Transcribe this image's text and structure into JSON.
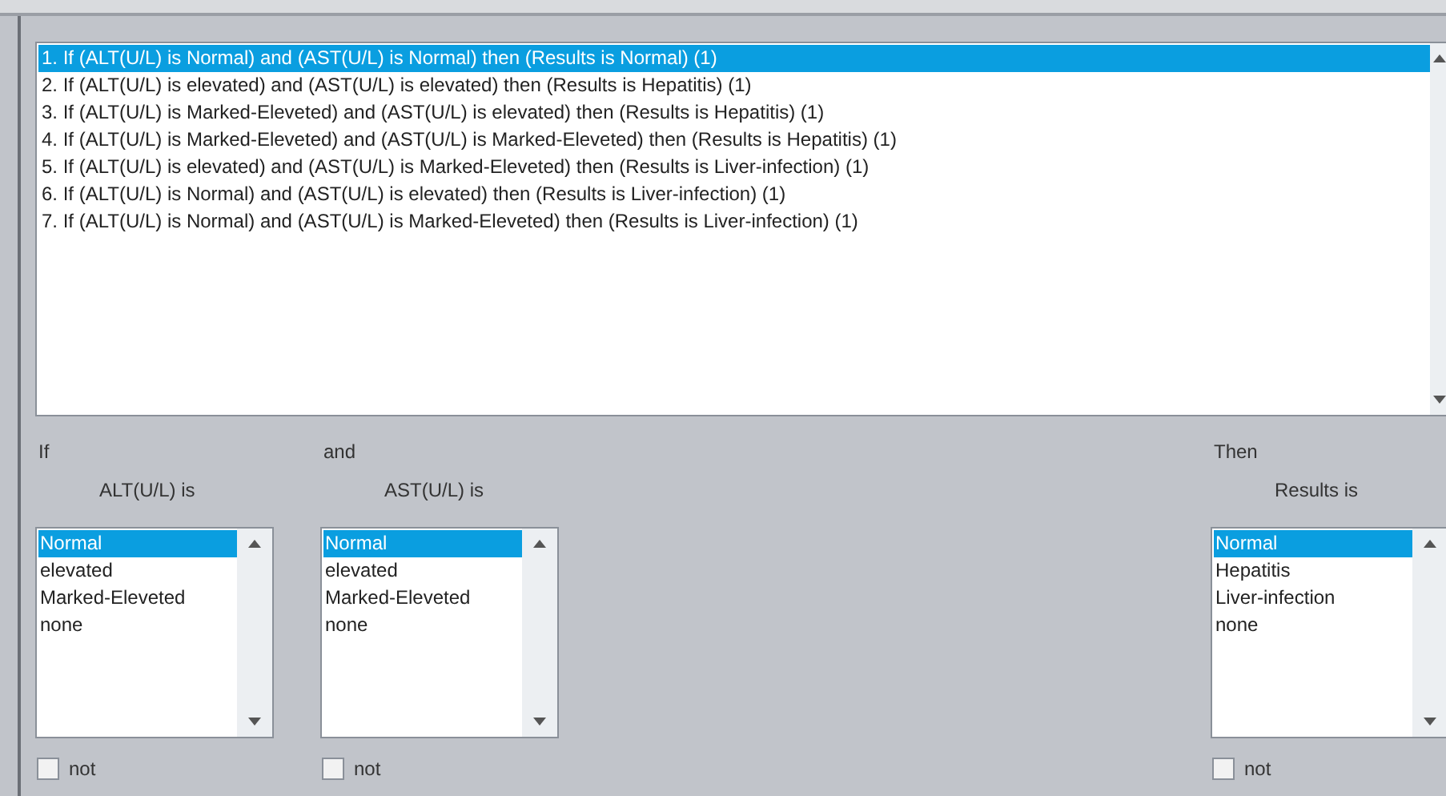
{
  "rules": [
    {
      "text": "1. If (ALT(U/L) is Normal) and (AST(U/L) is Normal) then (Results is Normal) (1)",
      "selected": true
    },
    {
      "text": "2. If (ALT(U/L) is elevated) and (AST(U/L) is elevated) then (Results is Hepatitis) (1)",
      "selected": false
    },
    {
      "text": "3. If (ALT(U/L) is Marked-Eleveted) and (AST(U/L) is elevated) then (Results is Hepatitis) (1)",
      "selected": false
    },
    {
      "text": "4. If (ALT(U/L) is Marked-Eleveted) and (AST(U/L) is Marked-Eleveted) then (Results is Hepatitis) (1)",
      "selected": false
    },
    {
      "text": "5. If (ALT(U/L) is elevated) and (AST(U/L) is Marked-Eleveted) then (Results is Liver-infection) (1)",
      "selected": false
    },
    {
      "text": "6. If (ALT(U/L) is Normal) and (AST(U/L) is elevated) then (Results is Liver-infection) (1)",
      "selected": false
    },
    {
      "text": "7. If (ALT(U/L) is Normal) and (AST(U/L) is Marked-Eleveted) then (Results is Liver-infection) (1)",
      "selected": false
    }
  ],
  "columns": [
    {
      "connector": "If",
      "variable": "ALT(U/L) is",
      "options": [
        {
          "label": "Normal",
          "selected": true
        },
        {
          "label": "elevated",
          "selected": false
        },
        {
          "label": "Marked-Eleveted",
          "selected": false
        },
        {
          "label": "none",
          "selected": false
        }
      ],
      "not_label": "not",
      "not_checked": false
    },
    {
      "connector": "and",
      "variable": "AST(U/L) is",
      "options": [
        {
          "label": "Normal",
          "selected": true
        },
        {
          "label": "elevated",
          "selected": false
        },
        {
          "label": "Marked-Eleveted",
          "selected": false
        },
        {
          "label": "none",
          "selected": false
        }
      ],
      "not_label": "not",
      "not_checked": false
    },
    {
      "connector": "Then",
      "variable": "Results is",
      "options": [
        {
          "label": "Normal",
          "selected": true
        },
        {
          "label": "Hepatitis",
          "selected": false
        },
        {
          "label": "Liver-infection",
          "selected": false
        },
        {
          "label": "none",
          "selected": false
        }
      ],
      "not_label": "not",
      "not_checked": false
    }
  ]
}
